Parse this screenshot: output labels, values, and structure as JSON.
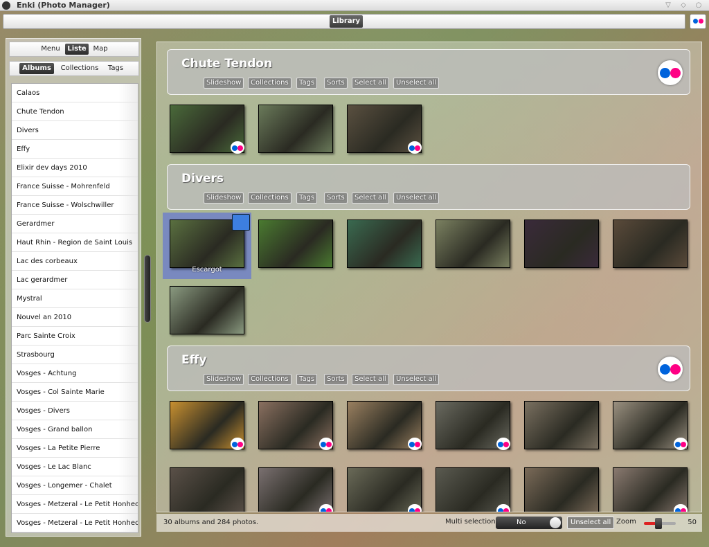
{
  "window": {
    "title": "Enki (Photo Manager)",
    "controls": [
      "minimize",
      "maximize",
      "close"
    ]
  },
  "header": {
    "tab": "Library",
    "service_icon": "flickr-icon"
  },
  "sidebar": {
    "view_tabs": [
      {
        "label": "Menu",
        "active": false
      },
      {
        "label": "Liste",
        "active": true
      },
      {
        "label": "Map",
        "active": false
      }
    ],
    "group_tabs": [
      {
        "label": "Albums",
        "active": true
      },
      {
        "label": "Collections",
        "active": false
      },
      {
        "label": "Tags",
        "active": false
      }
    ],
    "albums": [
      "Calaos",
      "Chute Tendon",
      "Divers",
      "Effy",
      "Elixir dev days 2010",
      "France Suisse - Mohrenfeld",
      "France Suisse - Wolschwiller",
      "Gerardmer",
      "Haut Rhin - Region de Saint Louis",
      "Lac des corbeaux",
      "Lac gerardmer",
      "Mystral",
      "Nouvel an 2010",
      "Parc Sainte Croix",
      "Strasbourg",
      "Vosges - Achtung",
      "Vosges - Col Sainte Marie",
      "Vosges - Divers",
      "Vosges - Grand ballon",
      "Vosges - La Petite Pierre",
      "Vosges - Le Lac Blanc",
      "Vosges - Longemer - Chalet",
      "Vosges - Metzeral - Le Petit Honheck",
      "Vosges - Metzeral - Le Petit Honheck"
    ]
  },
  "album_buttons": [
    "Slideshow",
    "Collections",
    "Tags",
    "Sorts",
    "Select all",
    "Unselect all"
  ],
  "sections": [
    {
      "title": "Chute Tendon",
      "has_flickr": true,
      "photos": [
        {
          "color": "#4a6a3a",
          "flickr": true
        },
        {
          "color": "#6a7a5a",
          "flickr": false
        },
        {
          "color": "#5a5040",
          "flickr": true
        }
      ]
    },
    {
      "title": "Divers",
      "has_flickr": false,
      "photos": [
        {
          "color": "#5a7040",
          "flickr": false,
          "selected": true,
          "label": "Escargot"
        },
        {
          "color": "#4a7a30",
          "flickr": false
        },
        {
          "color": "#3a6a50",
          "flickr": false
        },
        {
          "color": "#7a8060",
          "flickr": false
        },
        {
          "color": "#3a2a3a",
          "flickr": false
        },
        {
          "color": "#5a4a3a",
          "flickr": false
        },
        {
          "color": "#8a9a80",
          "flickr": false
        }
      ]
    },
    {
      "title": "Effy",
      "has_flickr": true,
      "photos": [
        {
          "color": "#c89030",
          "flickr": true
        },
        {
          "color": "#8a7060",
          "flickr": true
        },
        {
          "color": "#9a8060",
          "flickr": true
        },
        {
          "color": "#6a6a60",
          "flickr": true
        },
        {
          "color": "#7a7060",
          "flickr": false
        },
        {
          "color": "#9a9080",
          "flickr": true
        },
        {
          "color": "#5a5048",
          "flickr": false
        },
        {
          "color": "#7a7070",
          "flickr": true
        },
        {
          "color": "#6a6a58",
          "flickr": true
        },
        {
          "color": "#5a5a50",
          "flickr": true
        },
        {
          "color": "#7a6a58",
          "flickr": false
        },
        {
          "color": "#8a7a70",
          "flickr": true
        }
      ]
    }
  ],
  "statusbar": {
    "summary": "30 albums and 284 photos.",
    "multi_selection_label": "Multi selection",
    "multi_selection_value": "No",
    "unselect_all": "Unselect all",
    "zoom_label": "Zoom",
    "zoom_value": "50"
  },
  "colors": {
    "flickr_blue": "#0063dc",
    "flickr_pink": "#ff0084",
    "selection": "#5064e6"
  }
}
